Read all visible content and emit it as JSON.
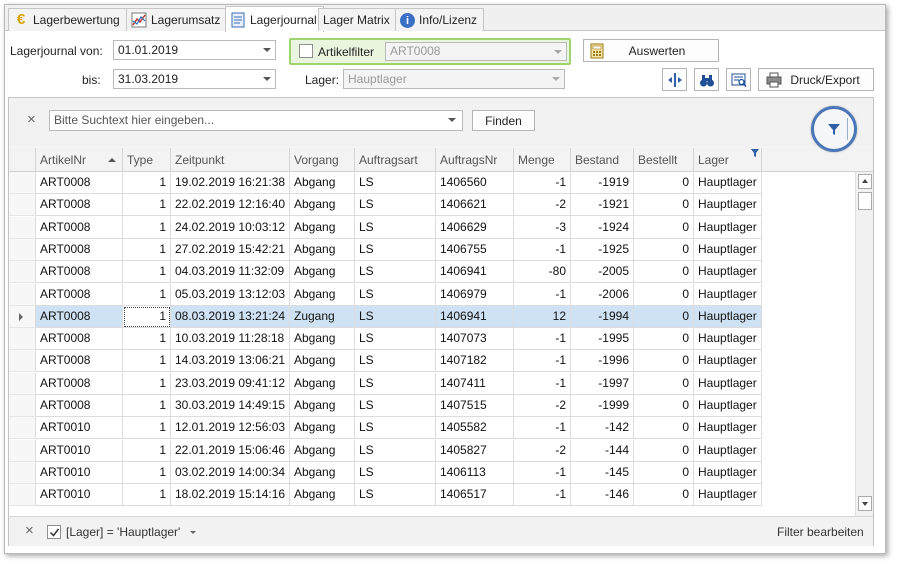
{
  "tabs": [
    {
      "label": "Lagerbewertung",
      "icon": "euro-icon",
      "active": false
    },
    {
      "label": "Lagerumsatz",
      "icon": "chart-icon",
      "active": false
    },
    {
      "label": "Lagerjournal",
      "icon": "journal-icon",
      "active": true
    },
    {
      "label": "Lager Matrix",
      "icon": "",
      "active": false
    },
    {
      "label": "Info/Lizenz",
      "icon": "info-icon",
      "active": false
    }
  ],
  "form": {
    "von_label": "Lagerjournal von:",
    "von_value": "01.01.2019",
    "bis_label": "bis:",
    "bis_value": "31.03.2019",
    "artikelfilter_label": "Artikelfilter",
    "artikelfilter_value": "ART0008",
    "lager_label": "Lager:",
    "lager_value": "Hauptlager",
    "auswerten_label": "Auswerten",
    "druck_label": "Druck/Export"
  },
  "findbar": {
    "search_placeholder": "Bitte Suchtext hier eingeben...",
    "finden_label": "Finden"
  },
  "grid": {
    "columns": [
      "ArtikelNr",
      "Type",
      "Zeitpunkt",
      "Vorgang",
      "Auftragsart",
      "AuftragsNr",
      "Menge",
      "Bestand",
      "Bestellt",
      "Lager"
    ],
    "rows": [
      [
        "ART0008",
        "1",
        "19.02.2019 16:21:38",
        "Abgang",
        "LS",
        "1406560",
        "-1",
        "-1919",
        "0",
        "Hauptlager"
      ],
      [
        "ART0008",
        "1",
        "22.02.2019 12:16:40",
        "Abgang",
        "LS",
        "1406621",
        "-2",
        "-1921",
        "0",
        "Hauptlager"
      ],
      [
        "ART0008",
        "1",
        "24.02.2019 10:03:12",
        "Abgang",
        "LS",
        "1406629",
        "-3",
        "-1924",
        "0",
        "Hauptlager"
      ],
      [
        "ART0008",
        "1",
        "27.02.2019 15:42:21",
        "Abgang",
        "LS",
        "1406755",
        "-1",
        "-1925",
        "0",
        "Hauptlager"
      ],
      [
        "ART0008",
        "1",
        "04.03.2019 11:32:09",
        "Abgang",
        "LS",
        "1406941",
        "-80",
        "-2005",
        "0",
        "Hauptlager"
      ],
      [
        "ART0008",
        "1",
        "05.03.2019 13:12:03",
        "Abgang",
        "LS",
        "1406979",
        "-1",
        "-2006",
        "0",
        "Hauptlager"
      ],
      [
        "ART0008",
        "1",
        "08.03.2019 13:21:24",
        "Zugang",
        "LS",
        "1406941",
        "12",
        "-1994",
        "0",
        "Hauptlager"
      ],
      [
        "ART0008",
        "1",
        "10.03.2019 11:28:18",
        "Abgang",
        "LS",
        "1407073",
        "-1",
        "-1995",
        "0",
        "Hauptlager"
      ],
      [
        "ART0008",
        "1",
        "14.03.2019 13:06:21",
        "Abgang",
        "LS",
        "1407182",
        "-1",
        "-1996",
        "0",
        "Hauptlager"
      ],
      [
        "ART0008",
        "1",
        "23.03.2019 09:41:12",
        "Abgang",
        "LS",
        "1407411",
        "-1",
        "-1997",
        "0",
        "Hauptlager"
      ],
      [
        "ART0008",
        "1",
        "30.03.2019 14:49:15",
        "Abgang",
        "LS",
        "1407515",
        "-2",
        "-1999",
        "0",
        "Hauptlager"
      ],
      [
        "ART0010",
        "1",
        "12.01.2019 12:56:03",
        "Abgang",
        "LS",
        "1405582",
        "-1",
        "-142",
        "0",
        "Hauptlager"
      ],
      [
        "ART0010",
        "1",
        "22.01.2019 15:06:46",
        "Abgang",
        "LS",
        "1405827",
        "-2",
        "-144",
        "0",
        "Hauptlager"
      ],
      [
        "ART0010",
        "1",
        "03.02.2019 14:00:34",
        "Abgang",
        "LS",
        "1406113",
        "-1",
        "-145",
        "0",
        "Hauptlager"
      ],
      [
        "ART0010",
        "1",
        "18.02.2019 15:14:16",
        "Abgang",
        "LS",
        "1406517",
        "-1",
        "-146",
        "0",
        "Hauptlager"
      ]
    ],
    "selected_row": 6
  },
  "filterbar": {
    "expression": "[Lager] = 'Hauptlager'",
    "edit_label": "Filter bearbeiten"
  }
}
